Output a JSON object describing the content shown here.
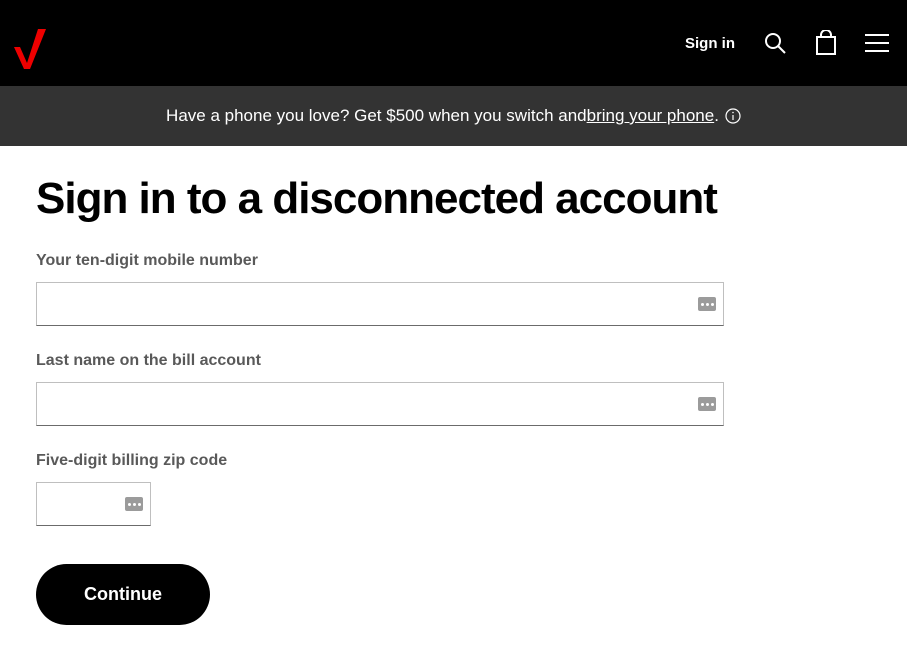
{
  "header": {
    "sign_in_label": "Sign in"
  },
  "promo": {
    "text_before_link": "Have a phone you love? Get $500 when you switch and ",
    "link_text": "bring your phone",
    "text_after_link": "."
  },
  "page": {
    "title": "Sign in to a disconnected account"
  },
  "form": {
    "mobile_label": "Your ten-digit mobile number",
    "mobile_value": "",
    "lastname_label": "Last name on the bill account",
    "lastname_value": "",
    "zip_label": "Five-digit billing zip code",
    "zip_value": "",
    "continue_label": "Continue"
  }
}
